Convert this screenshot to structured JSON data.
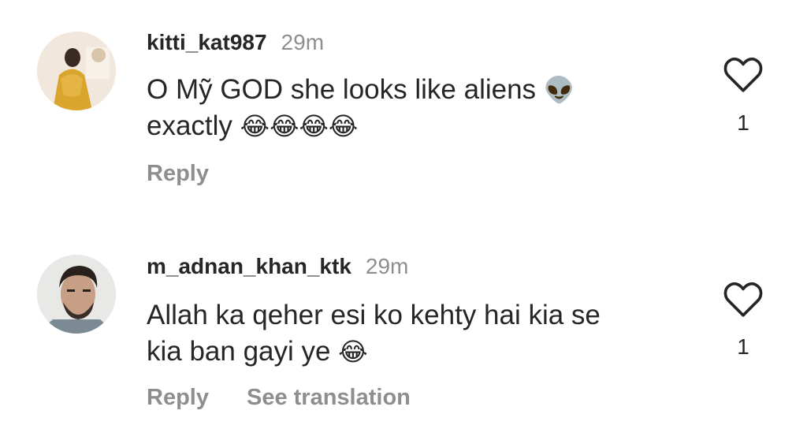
{
  "comments": [
    {
      "username": "kitti_kat987",
      "time": "29m",
      "text_line1": "O Mỹ GOD she looks like aliens",
      "text_emoji1": "👽",
      "text_line2": "exactly",
      "text_emoji2": "😂😂😂😂",
      "reply_label": "Reply",
      "like_count": "1",
      "avatar_icon": "avatar-woman-yellow-dress",
      "like_icon": "heart-outline-icon"
    },
    {
      "username": "m_adnan_khan_ktk",
      "time": "29m",
      "text_line1": "Allah ka qeher esi ko kehty hai kia se",
      "text_line2": "kia ban gayi ye",
      "text_emoji2": "😂",
      "reply_label": "Reply",
      "translate_label": "See translation",
      "like_count": "1",
      "avatar_icon": "avatar-man-portrait",
      "like_icon": "heart-outline-icon"
    }
  ],
  "colors": {
    "username": "#262626",
    "meta": "#8e8e8e",
    "background": "#ffffff"
  }
}
